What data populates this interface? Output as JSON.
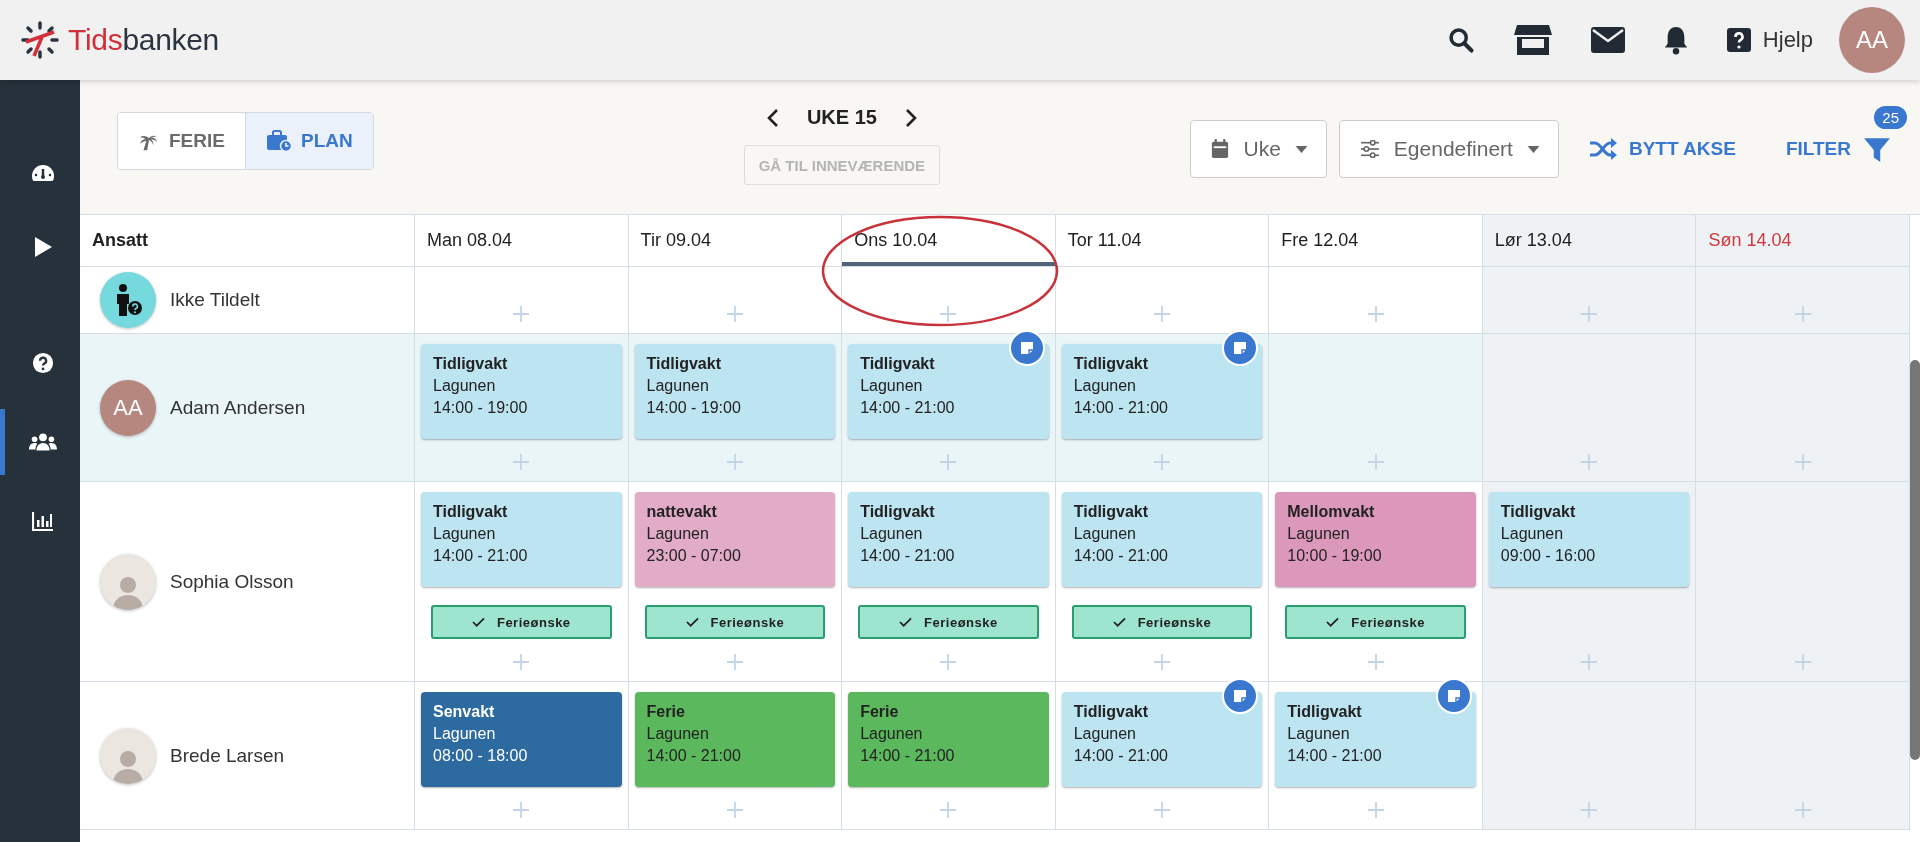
{
  "header": {
    "logo": {
      "accent": "Tids",
      "rest": "banken"
    },
    "help_label": "Hjelp",
    "avatar_initials": "AA"
  },
  "sidebar": {
    "items": [
      {
        "kind": "gauge",
        "selected": false
      },
      {
        "kind": "play",
        "selected": false
      },
      {
        "kind": "help",
        "selected": false
      },
      {
        "kind": "people",
        "selected": true
      },
      {
        "kind": "chart",
        "selected": false
      }
    ]
  },
  "toolbar": {
    "view_toggle": [
      {
        "kind": "vacation",
        "label": "FERIE",
        "selected": false
      },
      {
        "kind": "plan",
        "label": "PLAN",
        "selected": true
      }
    ],
    "week": "UKE 15",
    "go_to_current": {
      "label": "GÅ TIL INNEVÆRENDE",
      "disabled": true
    },
    "period_dropdown": "Uke",
    "layout_dropdown": "Egendefinert",
    "swap_axis": "BYTT AKSE",
    "filter": {
      "label": "FILTER",
      "count": "25"
    }
  },
  "schedule": {
    "employee_header": "Ansatt",
    "days": [
      {
        "label": "Man 08.04",
        "kind": "weekday",
        "selected": false
      },
      {
        "label": "Tir 09.04",
        "kind": "weekday",
        "selected": false
      },
      {
        "label": "Ons 10.04",
        "kind": "weekday",
        "selected": true
      },
      {
        "label": "Tor 11.04",
        "kind": "weekday",
        "selected": false
      },
      {
        "label": "Fre 12.04",
        "kind": "weekday",
        "selected": false
      },
      {
        "label": "Lør 13.04",
        "kind": "saturday",
        "selected": false
      },
      {
        "label": "Søn 14.04",
        "kind": "sunday",
        "selected": false
      }
    ],
    "rows": [
      {
        "name": "Ikke Tildelt",
        "kind": "unassigned",
        "highlighted": false,
        "cells": [
          {},
          {},
          {},
          {},
          {},
          {},
          {}
        ]
      },
      {
        "name": "Adam Andersen",
        "kind": "initials",
        "initials": "AA",
        "highlighted": true,
        "cells": [
          {
            "shift": {
              "title": "Tidligvakt",
              "place": "Lagunen",
              "time": "14:00 - 19:00",
              "color": "#bde4f1",
              "note": false
            }
          },
          {
            "shift": {
              "title": "Tidligvakt",
              "place": "Lagunen",
              "time": "14:00 - 19:00",
              "color": "#bde4f1",
              "note": false
            }
          },
          {
            "shift": {
              "title": "Tidligvakt",
              "place": "Lagunen",
              "time": "14:00 - 21:00",
              "color": "#bde4f1",
              "note": true
            }
          },
          {
            "shift": {
              "title": "Tidligvakt",
              "place": "Lagunen",
              "time": "14:00 - 21:00",
              "color": "#bde4f1",
              "note": true
            }
          },
          {},
          {},
          {}
        ]
      },
      {
        "name": "Sophia Olsson",
        "kind": "photo",
        "highlighted": false,
        "cells": [
          {
            "shift": {
              "title": "Tidligvakt",
              "place": "Lagunen",
              "time": "14:00 - 21:00",
              "color": "#bde4f1",
              "note": false
            },
            "vacation_wish": "Ferieønske"
          },
          {
            "shift": {
              "title": "nattevakt",
              "place": "Lagunen",
              "time": "23:00 - 07:00",
              "color": "#e2abc8",
              "note": false
            },
            "vacation_wish": "Ferieønske"
          },
          {
            "shift": {
              "title": "Tidligvakt",
              "place": "Lagunen",
              "time": "14:00 - 21:00",
              "color": "#bde4f1",
              "note": false
            },
            "vacation_wish": "Ferieønske"
          },
          {
            "shift": {
              "title": "Tidligvakt",
              "place": "Lagunen",
              "time": "14:00 - 21:00",
              "color": "#bde4f1",
              "note": false
            },
            "vacation_wish": "Ferieønske"
          },
          {
            "shift": {
              "title": "Mellomvakt",
              "place": "Lagunen",
              "time": "10:00 - 19:00",
              "color": "#dc98bb",
              "note": false
            },
            "vacation_wish": "Ferieønske"
          },
          {
            "shift": {
              "title": "Tidligvakt",
              "place": "Lagunen",
              "time": "09:00 - 16:00",
              "color": "#bde4f1",
              "note": false
            }
          },
          {}
        ]
      },
      {
        "name": "Brede Larsen",
        "kind": "photo",
        "highlighted": false,
        "cells": [
          {
            "shift": {
              "title": "Senvakt",
              "place": "Lagunen",
              "time": "08:00 - 18:00",
              "color": "#2d6aa0",
              "note": false
            }
          },
          {
            "shift": {
              "title": "Ferie",
              "place": "Lagunen",
              "time": "14:00 - 21:00",
              "color": "#5cb85c",
              "note": false
            }
          },
          {
            "shift": {
              "title": "Ferie",
              "place": "Lagunen",
              "time": "14:00 - 21:00",
              "color": "#5cb85c",
              "note": false
            }
          },
          {
            "shift": {
              "title": "Tidligvakt",
              "place": "Lagunen",
              "time": "14:00 - 21:00",
              "color": "#bde4f1",
              "note": true
            }
          },
          {
            "shift": {
              "title": "Tidligvakt",
              "place": "Lagunen",
              "time": "14:00 - 21:00",
              "color": "#bde4f1",
              "note": true
            }
          },
          {},
          {}
        ]
      }
    ]
  }
}
